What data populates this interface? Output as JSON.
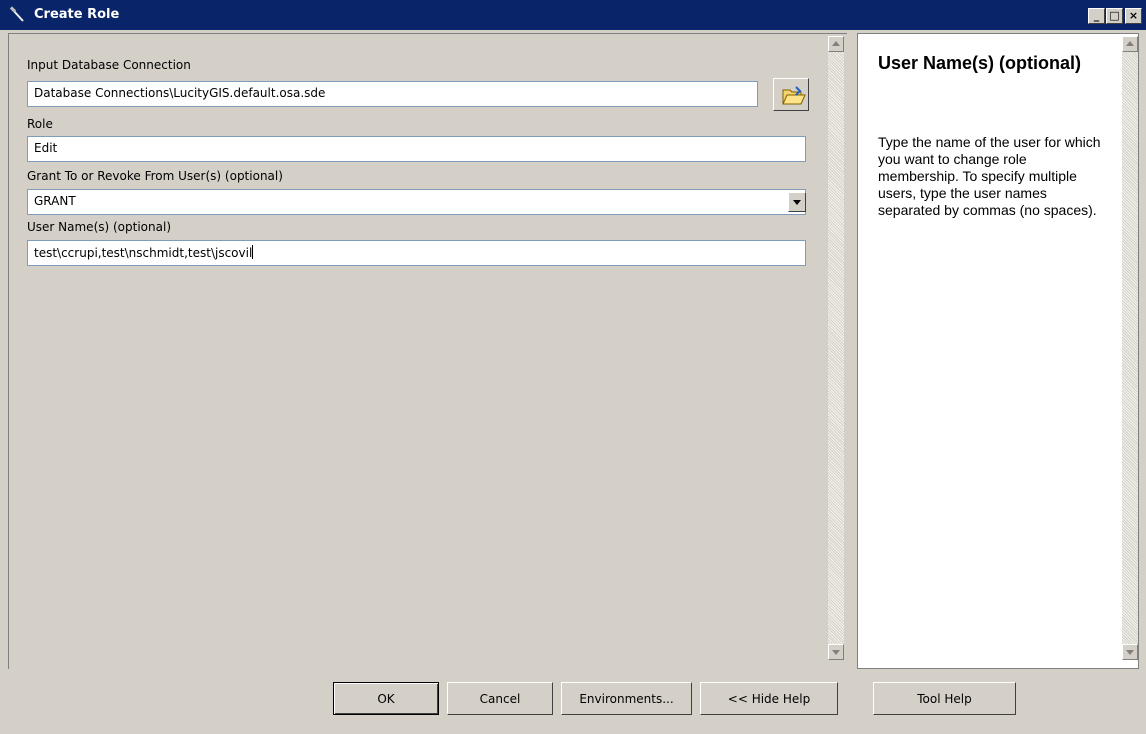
{
  "window": {
    "title": "Create Role",
    "minimize": "_",
    "maximize": "□",
    "close": "×"
  },
  "form": {
    "input_db": {
      "label": "Input Database Connection",
      "value": "Database Connections\\LucityGIS.default.osa.sde"
    },
    "role": {
      "label": "Role",
      "value": "Edit"
    },
    "grant": {
      "label": "Grant To or Revoke From User(s) (optional)",
      "value": "GRANT"
    },
    "users": {
      "label": "User Name(s) (optional)",
      "value": "test\\ccrupi,test\\nschmidt,test\\jscovil"
    }
  },
  "help": {
    "title": "User Name(s) (optional)",
    "body": "Type the name of the user for which you want to change role membership. To specify multiple users, type the user names separated by commas (no spaces)."
  },
  "buttons": {
    "ok": "OK",
    "cancel": "Cancel",
    "environments": "Environments...",
    "hide_help": "<< Hide Help",
    "tool_help": "Tool Help"
  },
  "icons": {
    "app": "hammer-icon",
    "browse": "folder-open-icon",
    "dropdown": "chevron-down-icon"
  }
}
